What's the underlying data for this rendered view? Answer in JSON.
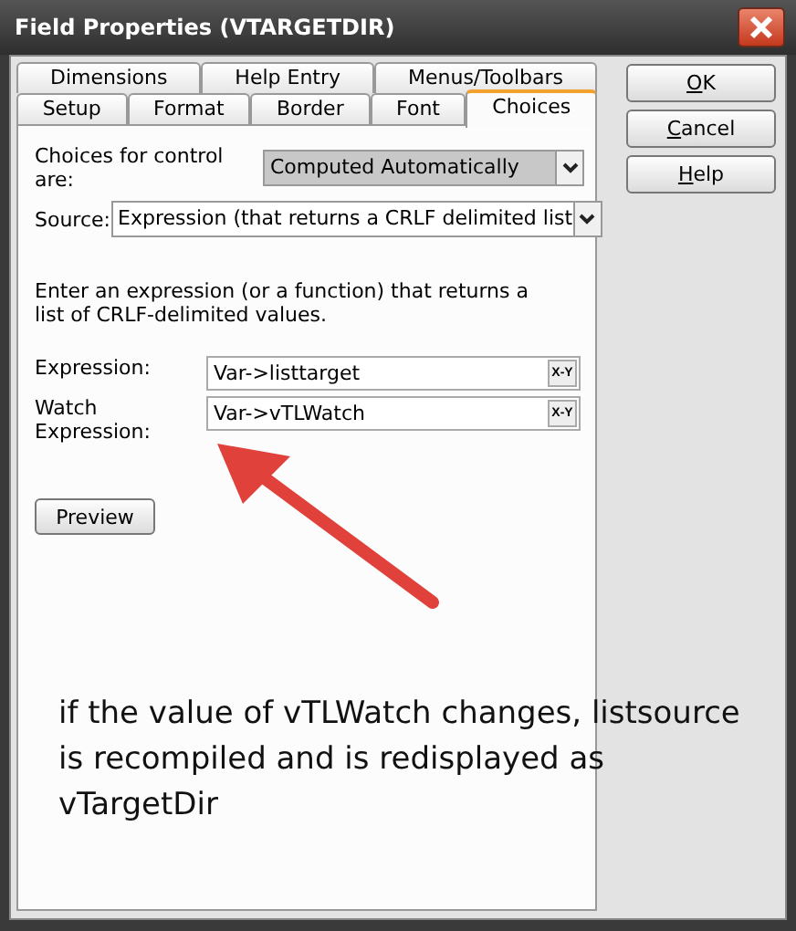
{
  "window": {
    "title": "Field Properties (VTARGETDIR)"
  },
  "tab_rows": [
    [
      {
        "label": "Dimensions",
        "selected": false
      },
      {
        "label": "Help Entry",
        "selected": false
      },
      {
        "label": "Menus/Toolbars",
        "selected": false
      }
    ],
    [
      {
        "label": "Setup",
        "selected": false
      },
      {
        "label": "Format",
        "selected": false
      },
      {
        "label": "Border",
        "selected": false
      },
      {
        "label": "Font",
        "selected": false
      },
      {
        "label": "Choices",
        "selected": true
      }
    ]
  ],
  "choices_for_control": {
    "label": "Choices for control are:",
    "value": "Computed Automatically",
    "disabled": true
  },
  "source": {
    "label": "Source:",
    "value": "Expression (that returns a CRLF delimited list",
    "disabled": false
  },
  "description": "Enter an expression (or a function) that returns a list of CRLF-delimited values.",
  "fields": [
    {
      "label": "Expression:",
      "value": "Var->listtarget",
      "button": "X-Y"
    },
    {
      "label": "Watch Expression:",
      "value": "Var->vTLWatch",
      "button": "X-Y"
    }
  ],
  "preview_button": "Preview",
  "buttons": [
    {
      "label": "OK",
      "mnemonic": true
    },
    {
      "label": "Cancel",
      "mnemonic": true
    },
    {
      "label": "Help",
      "mnemonic": true
    }
  ],
  "annotation": {
    "text": "if the value of vTLWatch changes, listsource is recompiled and is redisplayed as vTargetDir"
  }
}
